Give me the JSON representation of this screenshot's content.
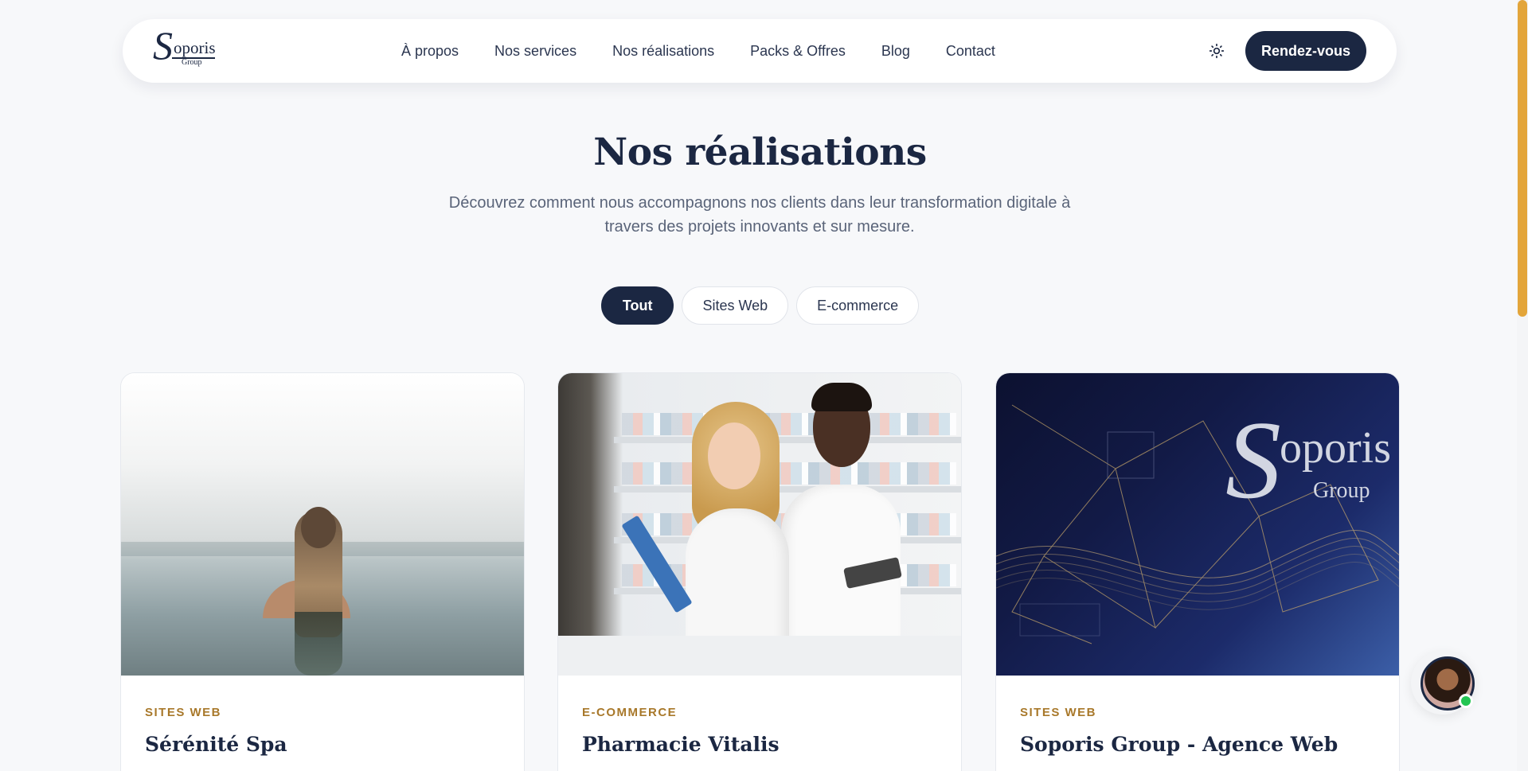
{
  "header": {
    "logo": {
      "initial": "S",
      "name": "oporis",
      "sub": "Group"
    },
    "nav": [
      {
        "label": "À propos"
      },
      {
        "label": "Nos services"
      },
      {
        "label": "Nos réalisations"
      },
      {
        "label": "Packs & Offres"
      },
      {
        "label": "Blog"
      },
      {
        "label": "Contact"
      }
    ],
    "theme_icon": "sun-icon",
    "cta_label": "Rendez-vous"
  },
  "hero": {
    "title": "Nos réalisations",
    "subtitle": "Découvrez comment nous accompagnons nos clients dans leur transformation digitale à travers des projets innovants et sur mesure."
  },
  "filters": [
    {
      "label": "Tout",
      "active": true
    },
    {
      "label": "Sites Web",
      "active": false
    },
    {
      "label": "E-commerce",
      "active": false
    }
  ],
  "projects": [
    {
      "category": "SITES WEB",
      "title": "Sérénité Spa"
    },
    {
      "category": "E-COMMERCE",
      "title": "Pharmacie Vitalis"
    },
    {
      "category": "SITES WEB",
      "title": "Soporis Group - Agence Web",
      "image_logo": {
        "initial": "S",
        "name": "oporis",
        "sub": "Group"
      }
    }
  ],
  "chat": {
    "icon": "support-avatar-icon",
    "status": "online"
  },
  "colors": {
    "primary": "#1b2742",
    "accent": "#a8782a",
    "scrollbar": "#e3a53a",
    "online": "#23c552"
  }
}
